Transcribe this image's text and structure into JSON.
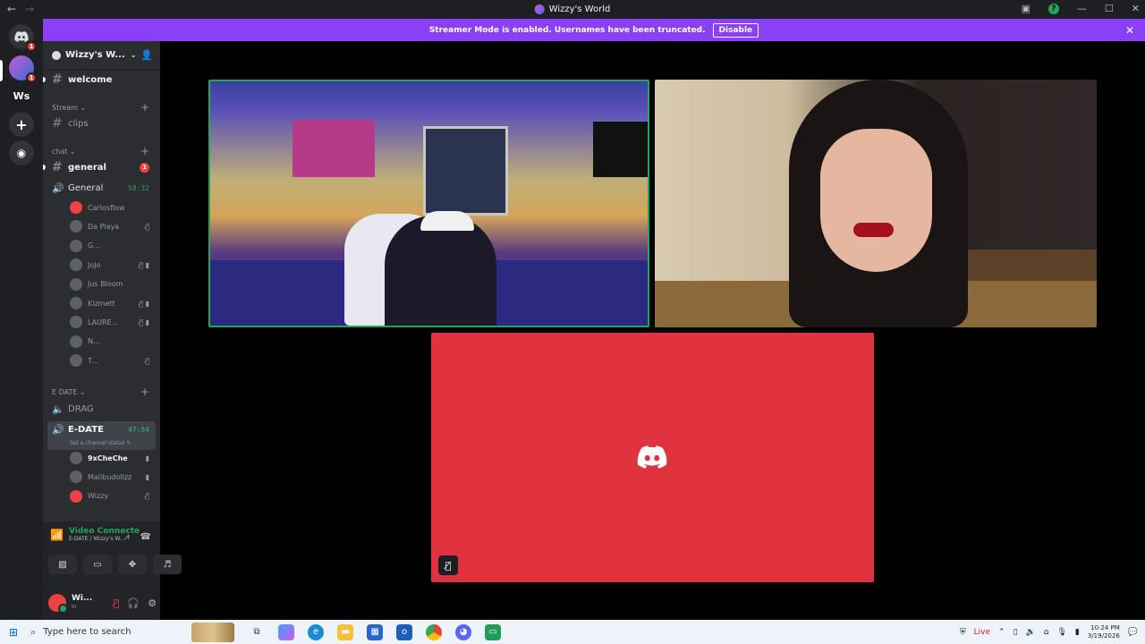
{
  "window": {
    "title": "Wizzy's World"
  },
  "banner": {
    "text": "Streamer Mode is enabled. Usernames have been truncated.",
    "button": "Disable"
  },
  "servers": [
    {
      "name": "discord-home",
      "badge": "1"
    },
    {
      "name": "wizzys-world",
      "badge": "1"
    },
    {
      "name": "Ws"
    }
  ],
  "server": {
    "name": "Wizzy's W..."
  },
  "channels": {
    "welcome": "welcome",
    "stream_cat": "Stream",
    "clips": "clips",
    "chat_cat": "chat",
    "general_text": "general",
    "general_text_badge": "1",
    "general_voice": "General",
    "general_timer": "58:32",
    "edate_cat": "E DATE",
    "drag": "DRAG",
    "edate_voice": "E-DATE",
    "edate_timer": "47:54",
    "edate_status": "Set a channel status"
  },
  "general_users": [
    {
      "name": "Carlosflow",
      "icons": ""
    },
    {
      "name": "Da Playa",
      "icons": "🎙̸"
    },
    {
      "name": "G...",
      "icons": ""
    },
    {
      "name": "JoJo",
      "icons": "🎙̸ ▮"
    },
    {
      "name": "Jus Bloom",
      "icons": ""
    },
    {
      "name": "Kizmett",
      "icons": "🎙̸ ▮"
    },
    {
      "name": "LAURE...",
      "icons": "🎙̸ ▮"
    },
    {
      "name": "N...",
      "icons": ""
    },
    {
      "name": "T...",
      "icons": "🎙̸"
    }
  ],
  "edate_users": [
    {
      "name": "9xCheChe",
      "icons": "▮"
    },
    {
      "name": "Malibudollzz",
      "icons": "▮"
    },
    {
      "name": "Wizzy",
      "icons": "🎙̸"
    }
  ],
  "voice_panel": {
    "status": "Video Connecte",
    "location": "E-DATE / Wizzy's W..."
  },
  "me": {
    "name": "Wi...",
    "status": "In"
  },
  "taskbar": {
    "search_placeholder": "Type here to search",
    "live": "Live",
    "time": "10:24 PM",
    "date": "3/19/2026"
  },
  "colors": {
    "brand": "#5865f2",
    "banner": "#8b3ff6",
    "online": "#23a55a",
    "tile_red": "#e0323f"
  }
}
